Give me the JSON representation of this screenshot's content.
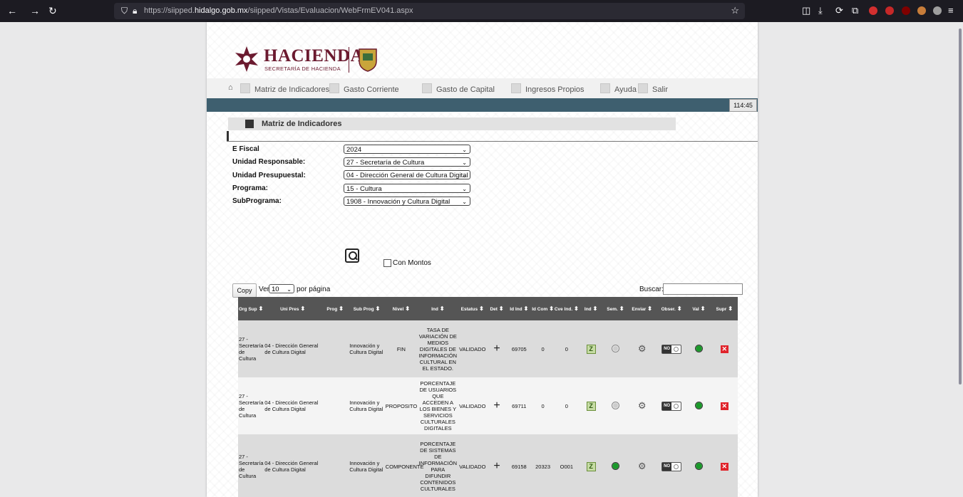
{
  "browser": {
    "url_prefix": "https://siipped.",
    "url_domain": "hidalgo.gob.mx",
    "url_path": "/siipped/Vistas/Evaluacion/WebFrmEV041.aspx"
  },
  "logo": {
    "title": "HACIENDA",
    "subtitle": "SECRETARÍA DE HACIENDA"
  },
  "menu": {
    "items": [
      "Matriz de Indicadores",
      "Gasto Corriente",
      "Gasto de Capital",
      "Ingresos Propios",
      "Ayuda",
      "Salir"
    ]
  },
  "session": {
    "timer": "114:45"
  },
  "section": {
    "title": "Matriz de Indicadores"
  },
  "form": {
    "fields": [
      {
        "label": "E Fiscal",
        "value": "2024"
      },
      {
        "label": "Unidad Responsable:",
        "value": "27 - Secretaría de Cultura"
      },
      {
        "label": "Unidad Presupuestal:",
        "value": "04 - Dirección General de Cultura Digital"
      },
      {
        "label": "Programa:",
        "value": "15 - Cultura"
      },
      {
        "label": "SubPrograma:",
        "value": "1908 - Innovación y Cultura Digital"
      }
    ],
    "con_montos": "Con Montos"
  },
  "table_controls": {
    "copy": "Copy",
    "ver": "Ver",
    "per_page_value": "10",
    "per_page": "por página",
    "search_label": "Buscar:"
  },
  "table": {
    "headers": [
      "Org Sup",
      "Uni Pres",
      "Prog",
      "Sub Prog",
      "Nivel",
      "Ind",
      "Estatus",
      "Det",
      "Id Ind",
      "Id Com",
      "Cve Ind.",
      "Ind",
      "Sem.",
      "Enviar",
      "Obser.",
      "Val",
      "Supr"
    ],
    "rows": [
      {
        "org": "27 - Secretaría de Cultura",
        "uni": "04 - Dirección General de Cultura Digital",
        "subprog": "Innovación y Cultura Digital",
        "nivel": "FIN",
        "ind": "TASA DE VARIACIÓN DE MEDIOS DIGITALES DE INFORMACIÓN CULTURAL EN EL ESTADO.",
        "estatus": "VALIDADO",
        "id_ind": "69705",
        "id_com": "0",
        "cve": "0",
        "sem": "grey"
      },
      {
        "org": "27 - Secretaría de Cultura",
        "uni": "04 - Dirección General de Cultura Digital",
        "subprog": "Innovación y Cultura Digital",
        "nivel": "PROPOSITO",
        "ind": "PORCENTAJE DE USUARIOS QUE ACCEDEN A LOS BIENES Y SERVICIOS CULTURALES DIGITALES",
        "estatus": "VALIDADO",
        "id_ind": "69711",
        "id_com": "0",
        "cve": "0",
        "sem": "grey"
      },
      {
        "org": "27 - Secretaría de Cultura",
        "uni": "04 - Dirección General de Cultura Digital",
        "subprog": "Innovación y Cultura Digital",
        "nivel": "COMPONENTE",
        "ind": "PORCENTAJE DE SISTEMAS DE INFORMACIÓN PARA DIFUNDIR CONTENIDOS CULTURALES",
        "estatus": "VALIDADO",
        "id_ind": "69158",
        "id_com": "20323",
        "cve": "O001",
        "sem": "green"
      }
    ],
    "toggle_label": "NO"
  }
}
